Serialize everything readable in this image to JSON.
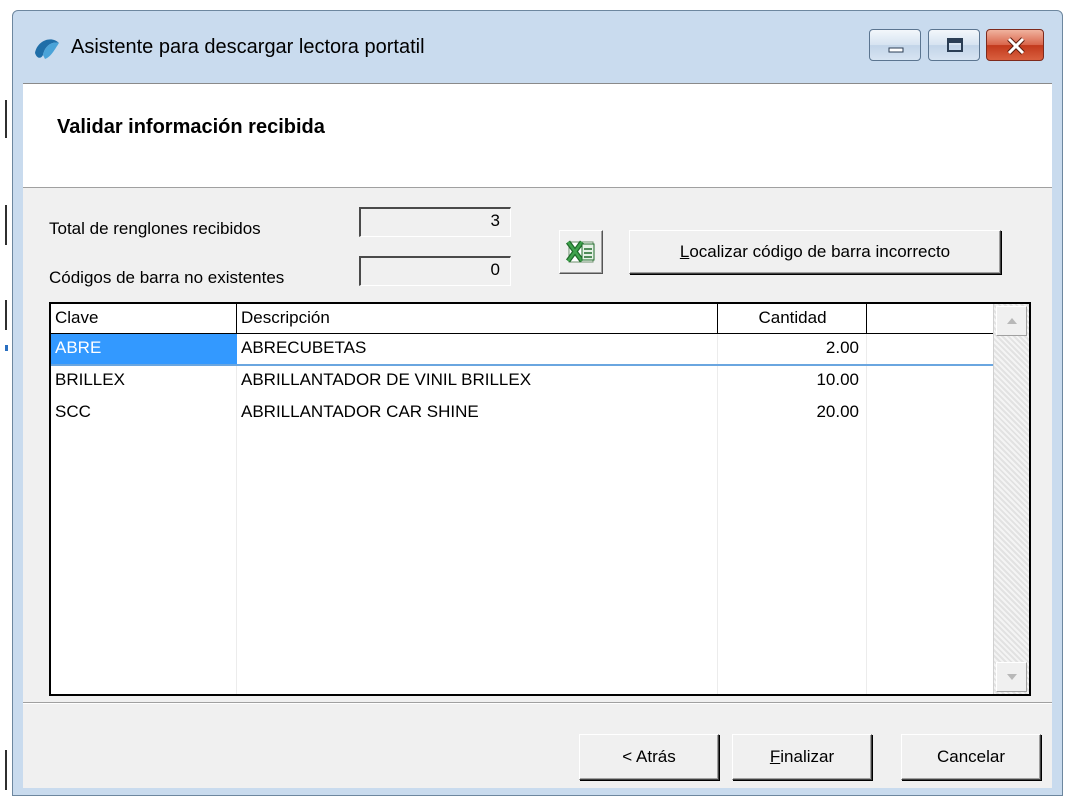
{
  "window": {
    "title": "Asistente para descargar lectora portatil"
  },
  "header": {
    "title": "Validar información recibida"
  },
  "summary": {
    "total_label": "Total de renglones recibidos",
    "total_value": "3",
    "missing_label": "Códigos de barra no existentes",
    "missing_value": "0"
  },
  "actions": {
    "excel_icon": "excel-icon",
    "locate_label_accel": "L",
    "locate_label_rest": "ocalizar código de barra incorrecto"
  },
  "grid": {
    "columns": [
      "Clave",
      "Descripción",
      "Cantidad"
    ],
    "rows": [
      {
        "clave": "ABRE",
        "descripcion": "ABRECUBETAS",
        "cantidad": "2.00"
      },
      {
        "clave": "BRILLEX",
        "descripcion": "ABRILLANTADOR DE VINIL BRILLEX",
        "cantidad": "10.00"
      },
      {
        "clave": "SCC",
        "descripcion": "ABRILLANTADOR CAR SHINE",
        "cantidad": "20.00"
      }
    ]
  },
  "footer": {
    "back_label": "< Atrás",
    "finish_accel": "F",
    "finish_rest": "inalizar",
    "cancel_label": "Cancelar"
  },
  "colors": {
    "selection": "#3399ff",
    "titlebar": "#c9dbee",
    "close_button": "#c7462a"
  }
}
